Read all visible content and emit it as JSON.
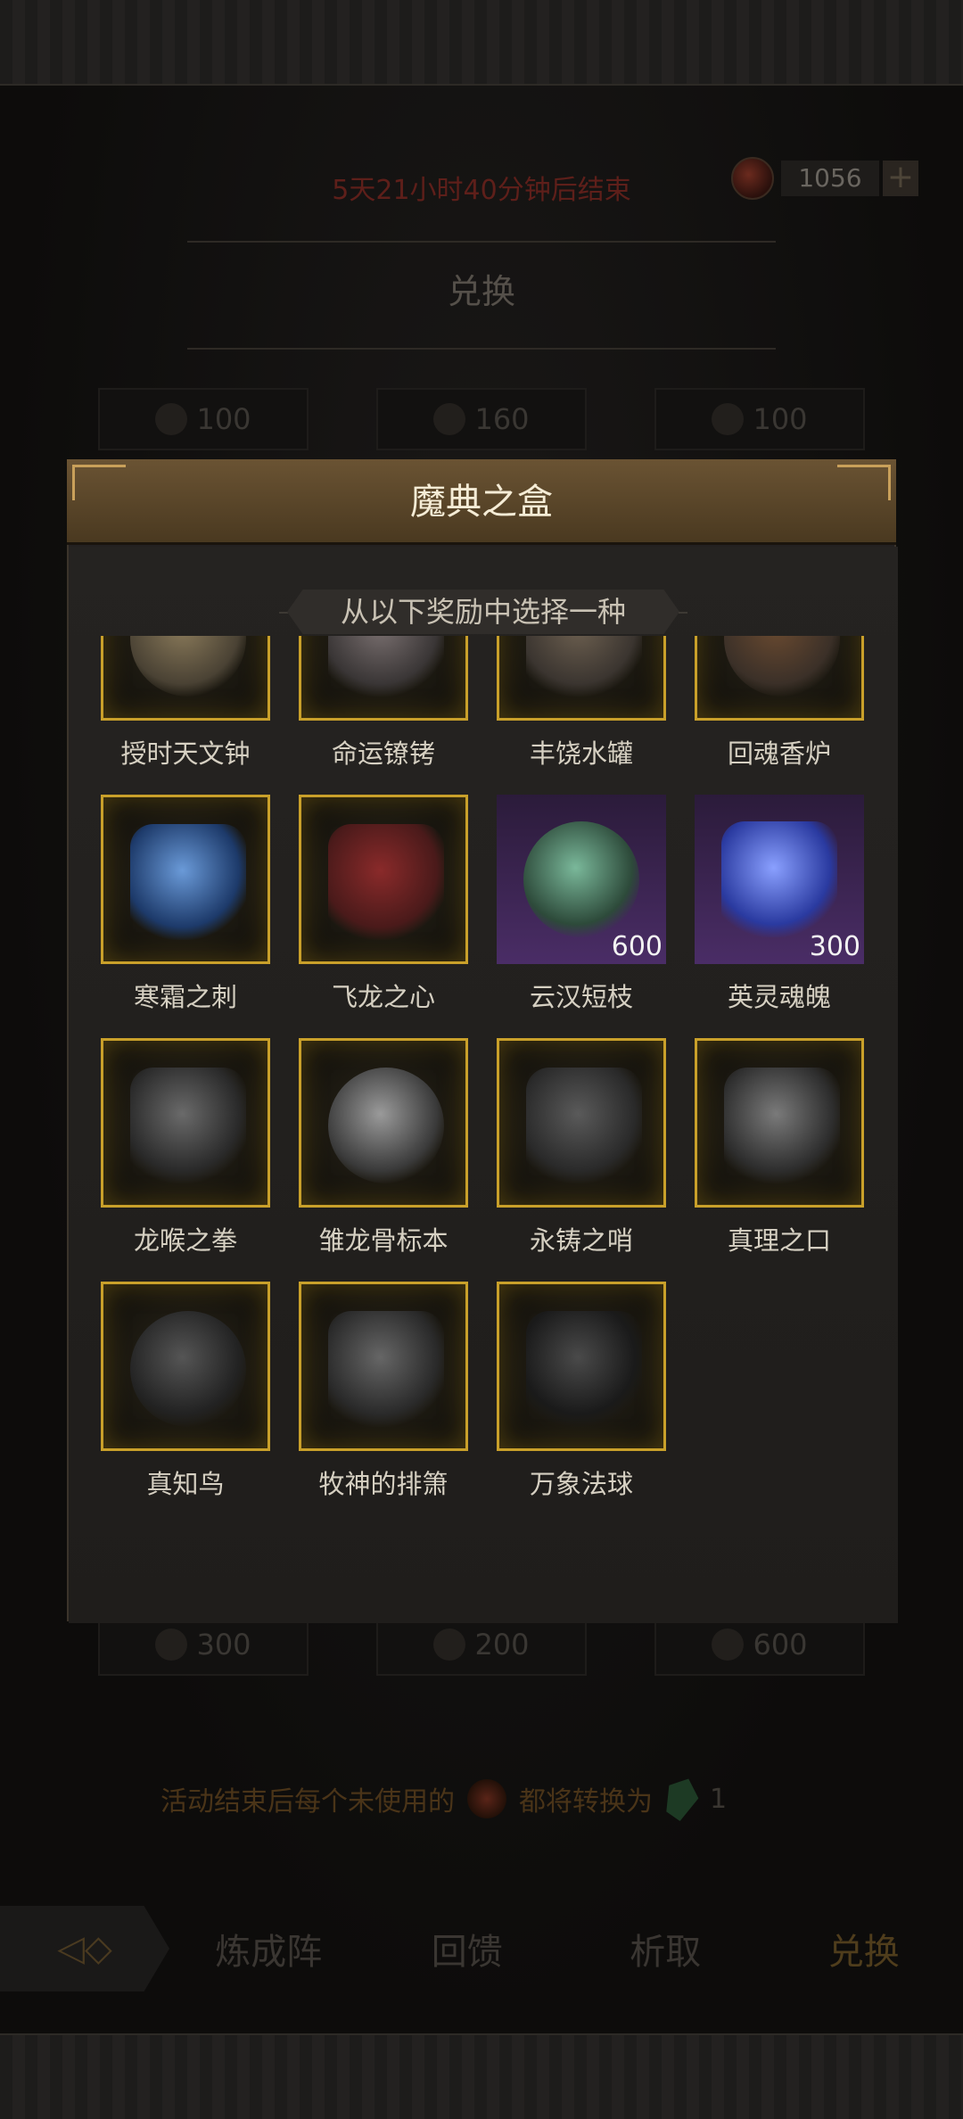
{
  "event": {
    "countdown": "5天21小时40分钟后结束",
    "currency_amount": "1056",
    "add_label": "+",
    "section_title": "兑换",
    "prices_top": [
      "100",
      "160",
      "100"
    ],
    "prices_bottom": [
      "300",
      "200",
      "600"
    ],
    "notice_text": "活动结束后每个未使用的",
    "notice_text2": "都将转换为",
    "notice_value": "1"
  },
  "modal": {
    "title": "魔典之盒",
    "subtitle": "从以下奖励中选择一种",
    "items": [
      {
        "label": "授时天文钟",
        "style": "gold"
      },
      {
        "label": "命运镣铐",
        "style": "gold"
      },
      {
        "label": "丰饶水罐",
        "style": "gold"
      },
      {
        "label": "回魂香炉",
        "style": "gold"
      },
      {
        "label": "寒霜之刺",
        "style": "gold"
      },
      {
        "label": "飞龙之心",
        "style": "gold"
      },
      {
        "label": "云汉短枝",
        "style": "purple",
        "qty": "600"
      },
      {
        "label": "英灵魂魄",
        "style": "purple",
        "qty": "300"
      },
      {
        "label": "龙喉之拳",
        "style": "gold"
      },
      {
        "label": "雏龙骨标本",
        "style": "gold"
      },
      {
        "label": "永铸之哨",
        "style": "gold"
      },
      {
        "label": "真理之口",
        "style": "gold"
      },
      {
        "label": "真知鸟",
        "style": "gold"
      },
      {
        "label": "牧神的排箫",
        "style": "gold"
      },
      {
        "label": "万象法球",
        "style": "gold"
      }
    ]
  },
  "nav": {
    "tabs": [
      "炼成阵",
      "回馈",
      "析取",
      "兑换"
    ],
    "active": "兑换"
  },
  "colors": {
    "gold_border": "#c9a02a",
    "header_brown": "#6a5333",
    "purple_tile": "#4a2d66"
  }
}
